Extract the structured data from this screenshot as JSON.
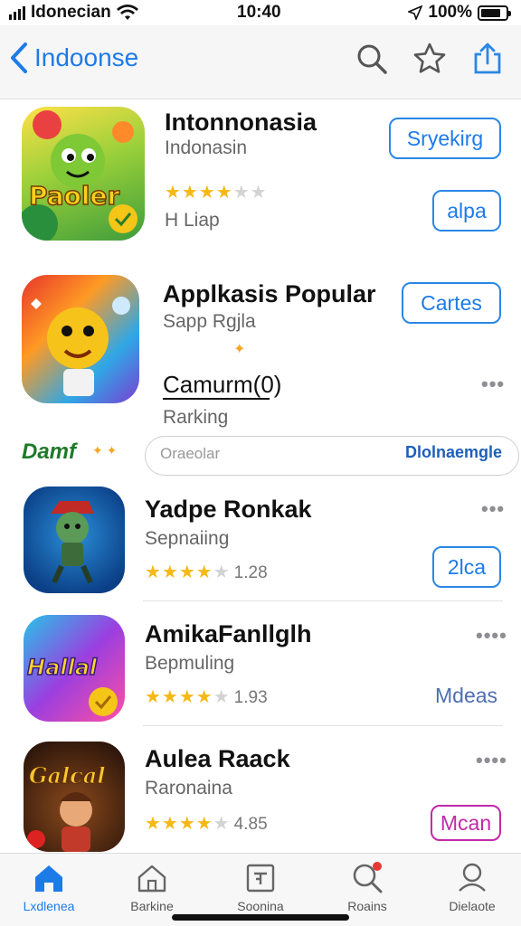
{
  "status_bar": {
    "carrier": "Idonecian",
    "time": "10:40",
    "battery_percent": "100%"
  },
  "navbar": {
    "back_label": "Indoonse"
  },
  "apps": [
    {
      "title": "Intonnonasia",
      "subtitle": "Indonasin",
      "button": "Sryekirg"
    },
    {
      "rating_stars": 4,
      "subtitle": "H Liap",
      "button": "alpa"
    },
    {
      "title": "Applkasis Popular",
      "subtitle": "Sapp Rgjla",
      "button": "Cartes"
    },
    {
      "title": "Camurm(0)",
      "subtitle": "Rarking"
    },
    {
      "title": "Yadpe Ronkak",
      "subtitle": "Sepnaiing",
      "rating_stars": 4,
      "rating_count": "1.28",
      "button": "2lca"
    },
    {
      "title": "AmikaFanllglh",
      "subtitle": "Bepmuling",
      "rating_stars": 4,
      "rating_count": "1.93",
      "link": "Mdeas"
    },
    {
      "title": "Aulea Raack",
      "subtitle": "Raronaina",
      "rating_stars": 4,
      "rating_count": "4.85",
      "button": "Mcan"
    }
  ],
  "banner": {
    "brand": "Damf",
    "input_placeholder": "Oraeolar",
    "link": "Dlolnaemgle"
  },
  "icon_art": {
    "icon1": "Paoler",
    "icon6": "Hallal",
    "icon7": "Galcal"
  },
  "tabs": [
    {
      "label": "Lxdlenea",
      "icon": "home-icon",
      "active": true
    },
    {
      "label": "Barkine",
      "icon": "house-outline-icon"
    },
    {
      "label": "Soonina",
      "icon": "apps-icon"
    },
    {
      "label": "Roains",
      "icon": "search-icon",
      "badge": true
    },
    {
      "label": "Dielaote",
      "icon": "profile-icon"
    }
  ],
  "colors": {
    "accent": "#1d7be8",
    "star": "#f5b916",
    "magenta_button": "#c22aa9"
  }
}
